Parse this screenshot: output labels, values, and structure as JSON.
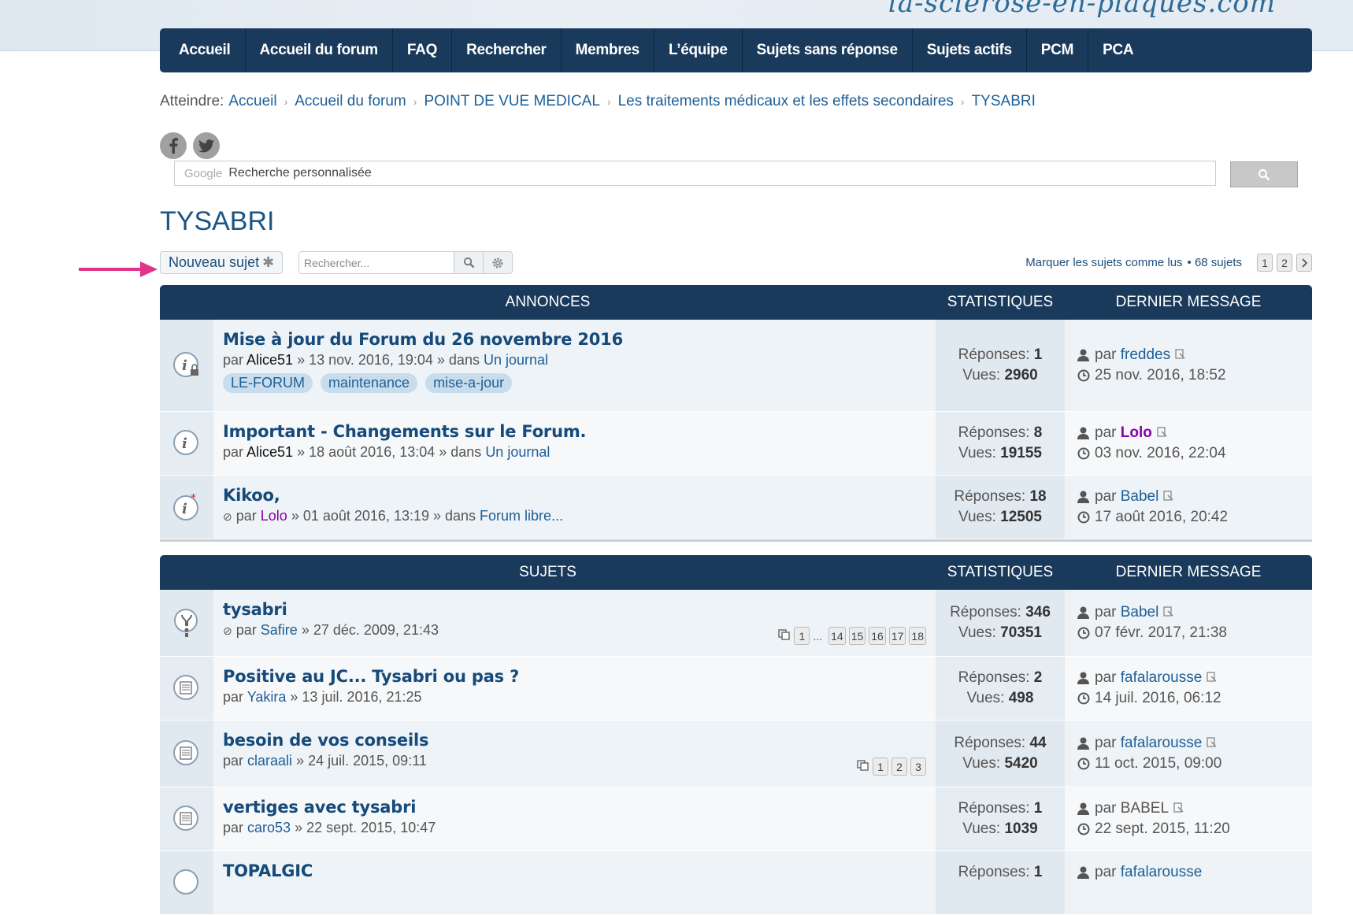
{
  "header": {
    "site_name": "la-sclerose-en-plaques.com"
  },
  "nav": [
    "Accueil",
    "Accueil du forum",
    "FAQ",
    "Rechercher",
    "Membres",
    "L’équipe",
    "Sujets sans réponse",
    "Sujets actifs",
    "PCM",
    "PCA"
  ],
  "breadcrumb": {
    "prefix": "Atteindre:",
    "items": [
      "Accueil",
      "Accueil du forum",
      "POINT DE VUE MEDICAL",
      "Les traitements médicaux et les effets secondaires",
      "TYSABRI"
    ]
  },
  "google_search": {
    "brand": "Google",
    "placeholder": "Recherche personnalisée"
  },
  "page_title": "TYSABRI",
  "toolbar": {
    "new_topic": "Nouveau sujet",
    "search_placeholder": "Rechercher...",
    "mark_read": "Marquer les sujets comme lus",
    "topic_count": "• 68 sujets",
    "pages": [
      "1",
      "2"
    ]
  },
  "announcements": {
    "header": {
      "title": "ANNONCES",
      "stats": "STATISTIQUES",
      "last": "DERNIER MESSAGE"
    },
    "rows": [
      {
        "title": "Mise à jour du Forum du 26 novembre 2016",
        "by": "par",
        "author": "Alice51",
        "date": "» 13 nov. 2016, 19:04 » dans",
        "forum": "Un journal",
        "tags": [
          "LE-FORUM",
          "maintenance",
          "mise-a-jour"
        ],
        "replies_label": "Réponses:",
        "replies": "1",
        "views_label": "Vues:",
        "views": "2960",
        "last_by": "par",
        "last_user": "freddes",
        "last_date": "25 nov. 2016, 18:52"
      },
      {
        "title": "Important - Changements sur le Forum.",
        "by": "par",
        "author": "Alice51",
        "date": "» 18 août 2016, 13:04 » dans",
        "forum": "Un journal",
        "replies_label": "Réponses:",
        "replies": "8",
        "views_label": "Vues:",
        "views": "19155",
        "last_by": "par",
        "last_user": "Lolo",
        "last_date": "03 nov. 2016, 22:04"
      },
      {
        "title": "Kikoo,",
        "by": "par",
        "author": "Lolo",
        "date": "» 01 août 2016, 13:19 » dans",
        "forum": "Forum libre...",
        "replies_label": "Réponses:",
        "replies": "18",
        "views_label": "Vues:",
        "views": "12505",
        "last_by": "par",
        "last_user": "Babel",
        "last_date": "17 août 2016, 20:42"
      }
    ]
  },
  "topics": {
    "header": {
      "title": "SUJETS",
      "stats": "STATISTIQUES",
      "last": "DERNIER MESSAGE"
    },
    "rows": [
      {
        "title": "tysabri",
        "by": "par",
        "author": "Safire",
        "date": "» 27 déc. 2009, 21:43",
        "pages": [
          "1",
          "...",
          "14",
          "15",
          "16",
          "17",
          "18"
        ],
        "replies_label": "Réponses:",
        "replies": "346",
        "views_label": "Vues:",
        "views": "70351",
        "last_by": "par",
        "last_user": "Babel",
        "last_date": "07 févr. 2017, 21:38"
      },
      {
        "title": "Positive au JC... Tysabri ou pas ?",
        "by": "par",
        "author": "Yakira",
        "date": "» 13 juil. 2016, 21:25",
        "replies_label": "Réponses:",
        "replies": "2",
        "views_label": "Vues:",
        "views": "498",
        "last_by": "par",
        "last_user": "fafalarousse",
        "last_date": "14 juil. 2016, 06:12"
      },
      {
        "title": "besoin de vos conseils",
        "by": "par",
        "author": "claraali",
        "date": "» 24 juil. 2015, 09:11",
        "pages": [
          "1",
          "2",
          "3"
        ],
        "replies_label": "Réponses:",
        "replies": "44",
        "views_label": "Vues:",
        "views": "5420",
        "last_by": "par",
        "last_user": "fafalarousse",
        "last_date": "11 oct. 2015, 09:00"
      },
      {
        "title": "vertiges avec tysabri",
        "by": "par",
        "author": "caro53",
        "date": "» 22 sept. 2015, 10:47",
        "replies_label": "Réponses:",
        "replies": "1",
        "views_label": "Vues:",
        "views": "1039",
        "last_by": "par",
        "last_user": "BABEL",
        "last_date": "22 sept. 2015, 11:20"
      },
      {
        "title": "TOPALGIC",
        "replies_label": "Réponses:",
        "replies": "1",
        "last_by": "par",
        "last_user": "fafalarousse"
      }
    ]
  },
  "colors": {
    "navbar": "#1a3a5c",
    "link": "#1d5f97",
    "arrow": "#e0348a",
    "purple_user": "#8800aa"
  }
}
